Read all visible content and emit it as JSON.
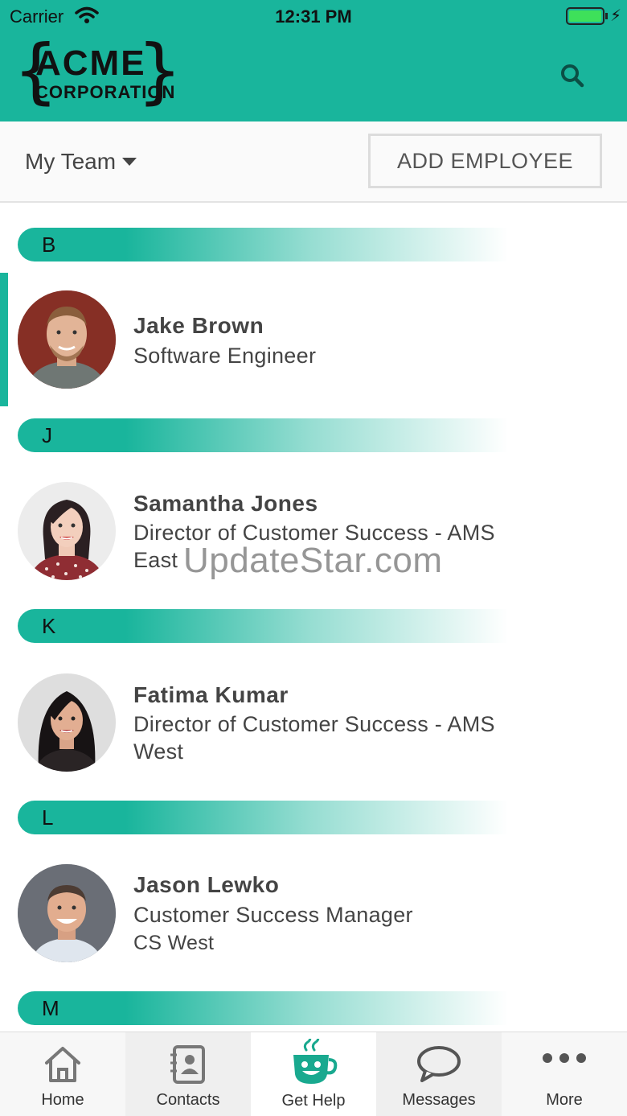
{
  "status": {
    "carrier": "Carrier",
    "time": "12:31 PM",
    "battery_icon": "battery-icon",
    "wifi_icon": "wifi-icon"
  },
  "header": {
    "logo_line1": "ACME",
    "logo_line2": "CORPORATION",
    "search_icon": "search-icon",
    "background_color": "#19b59c"
  },
  "toolbar": {
    "team_label": "My Team",
    "add_button_label": "ADD EMPLOYEE"
  },
  "sections": [
    {
      "letter": "B",
      "employees": [
        {
          "name": "Jake Brown",
          "role": "Software Engineer",
          "selected": true
        }
      ]
    },
    {
      "letter": "J",
      "employees": [
        {
          "name": "Samantha Jones",
          "role": "Director of Customer Success - AMS",
          "role_line2": "East"
        }
      ]
    },
    {
      "letter": "K",
      "employees": [
        {
          "name": "Fatima Kumar",
          "role": "Director of Customer Success - AMS",
          "role_line2": "West"
        }
      ]
    },
    {
      "letter": "L",
      "employees": [
        {
          "name": "Jason Lewko",
          "role": "Customer Success Manager",
          "subtitle": "CS West"
        }
      ]
    },
    {
      "letter": "M",
      "employees": []
    }
  ],
  "watermark": "UpdateStar.com",
  "tabs": [
    {
      "label": "Home",
      "icon": "home-icon"
    },
    {
      "label": "Contacts",
      "icon": "contacts-icon"
    },
    {
      "label": "Get Help",
      "icon": "coffee-cup-icon",
      "active": true
    },
    {
      "label": "Messages",
      "icon": "chat-bubble-icon"
    },
    {
      "label": "More",
      "icon": "more-dots-icon"
    }
  ]
}
